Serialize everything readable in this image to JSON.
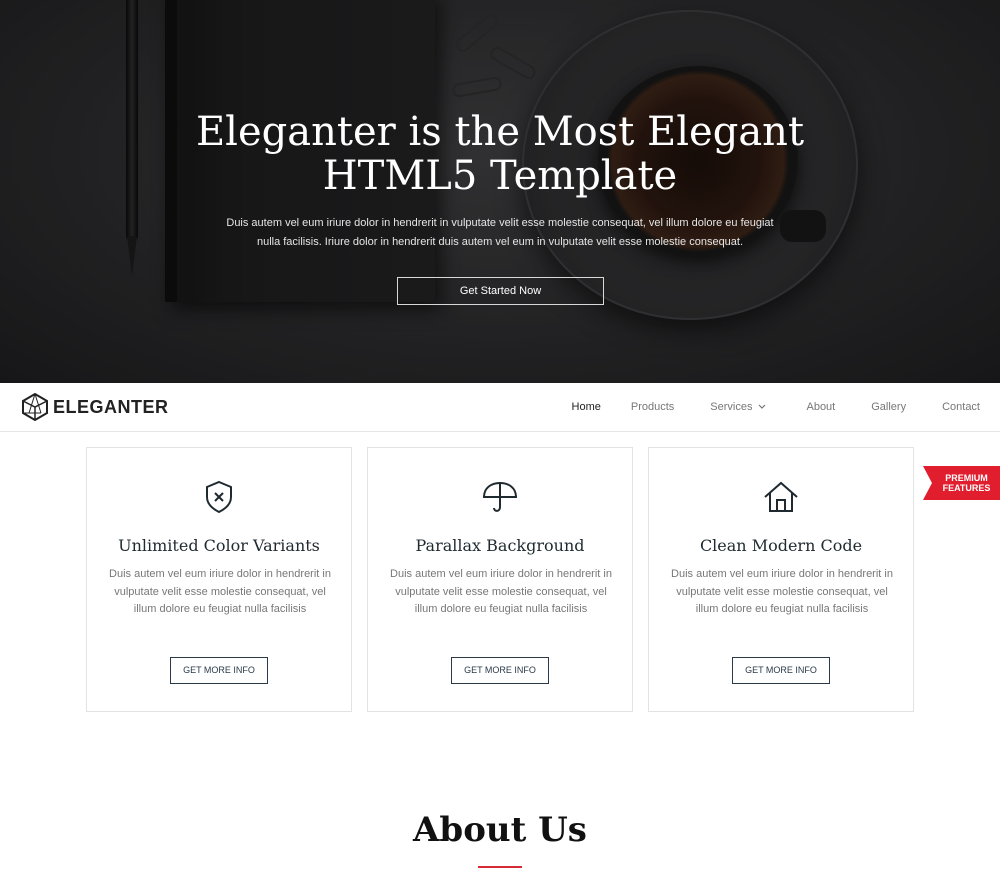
{
  "hero": {
    "title_line1": "Eleganter is the Most Elegant",
    "title_line2": "HTML5 Template",
    "text": "Duis autem vel eum iriure dolor in hendrerit in vulputate velit esse molestie consequat, vel illum dolore eu feugiat nulla facilisis. Iriure dolor in hendrerit duis autem vel eum in vulputate velit esse molestie consequat.",
    "button_label": "Get Started Now"
  },
  "brand": {
    "logo_text": "ELEGANTER",
    "accent_color": "#e01e2e",
    "dark_color": "#2a3a48"
  },
  "nav": {
    "items": [
      {
        "label": "Home",
        "active": true
      },
      {
        "label": "Products",
        "active": false
      },
      {
        "label": "Services",
        "active": false,
        "dropdown": true
      },
      {
        "label": "About",
        "active": false
      },
      {
        "label": "Gallery",
        "active": false
      },
      {
        "label": "Contact",
        "active": false
      }
    ]
  },
  "badge": {
    "line1": "PREMIUM",
    "line2": "FEATURES"
  },
  "features": [
    {
      "icon": "shield-x-icon",
      "title": "Unlimited Color Variants",
      "text": "Duis autem vel eum iriure dolor in hendrerit in vulputate velit esse molestie consequat, vel illum dolore eu feugiat nulla facilisis",
      "button_label": "GET MORE INFO"
    },
    {
      "icon": "umbrella-icon",
      "title": "Parallax Background",
      "text": "Duis autem vel eum iriure dolor in hendrerit in vulputate velit esse molestie consequat, vel illum dolore eu feugiat nulla facilisis",
      "button_label": "GET MORE INFO"
    },
    {
      "icon": "home-icon",
      "title": "Clean Modern Code",
      "text": "Duis autem vel eum iriure dolor in hendrerit in vulputate velit esse molestie consequat, vel illum dolore eu feugiat nulla facilisis",
      "button_label": "GET MORE INFO"
    }
  ],
  "about": {
    "title": "About Us"
  }
}
